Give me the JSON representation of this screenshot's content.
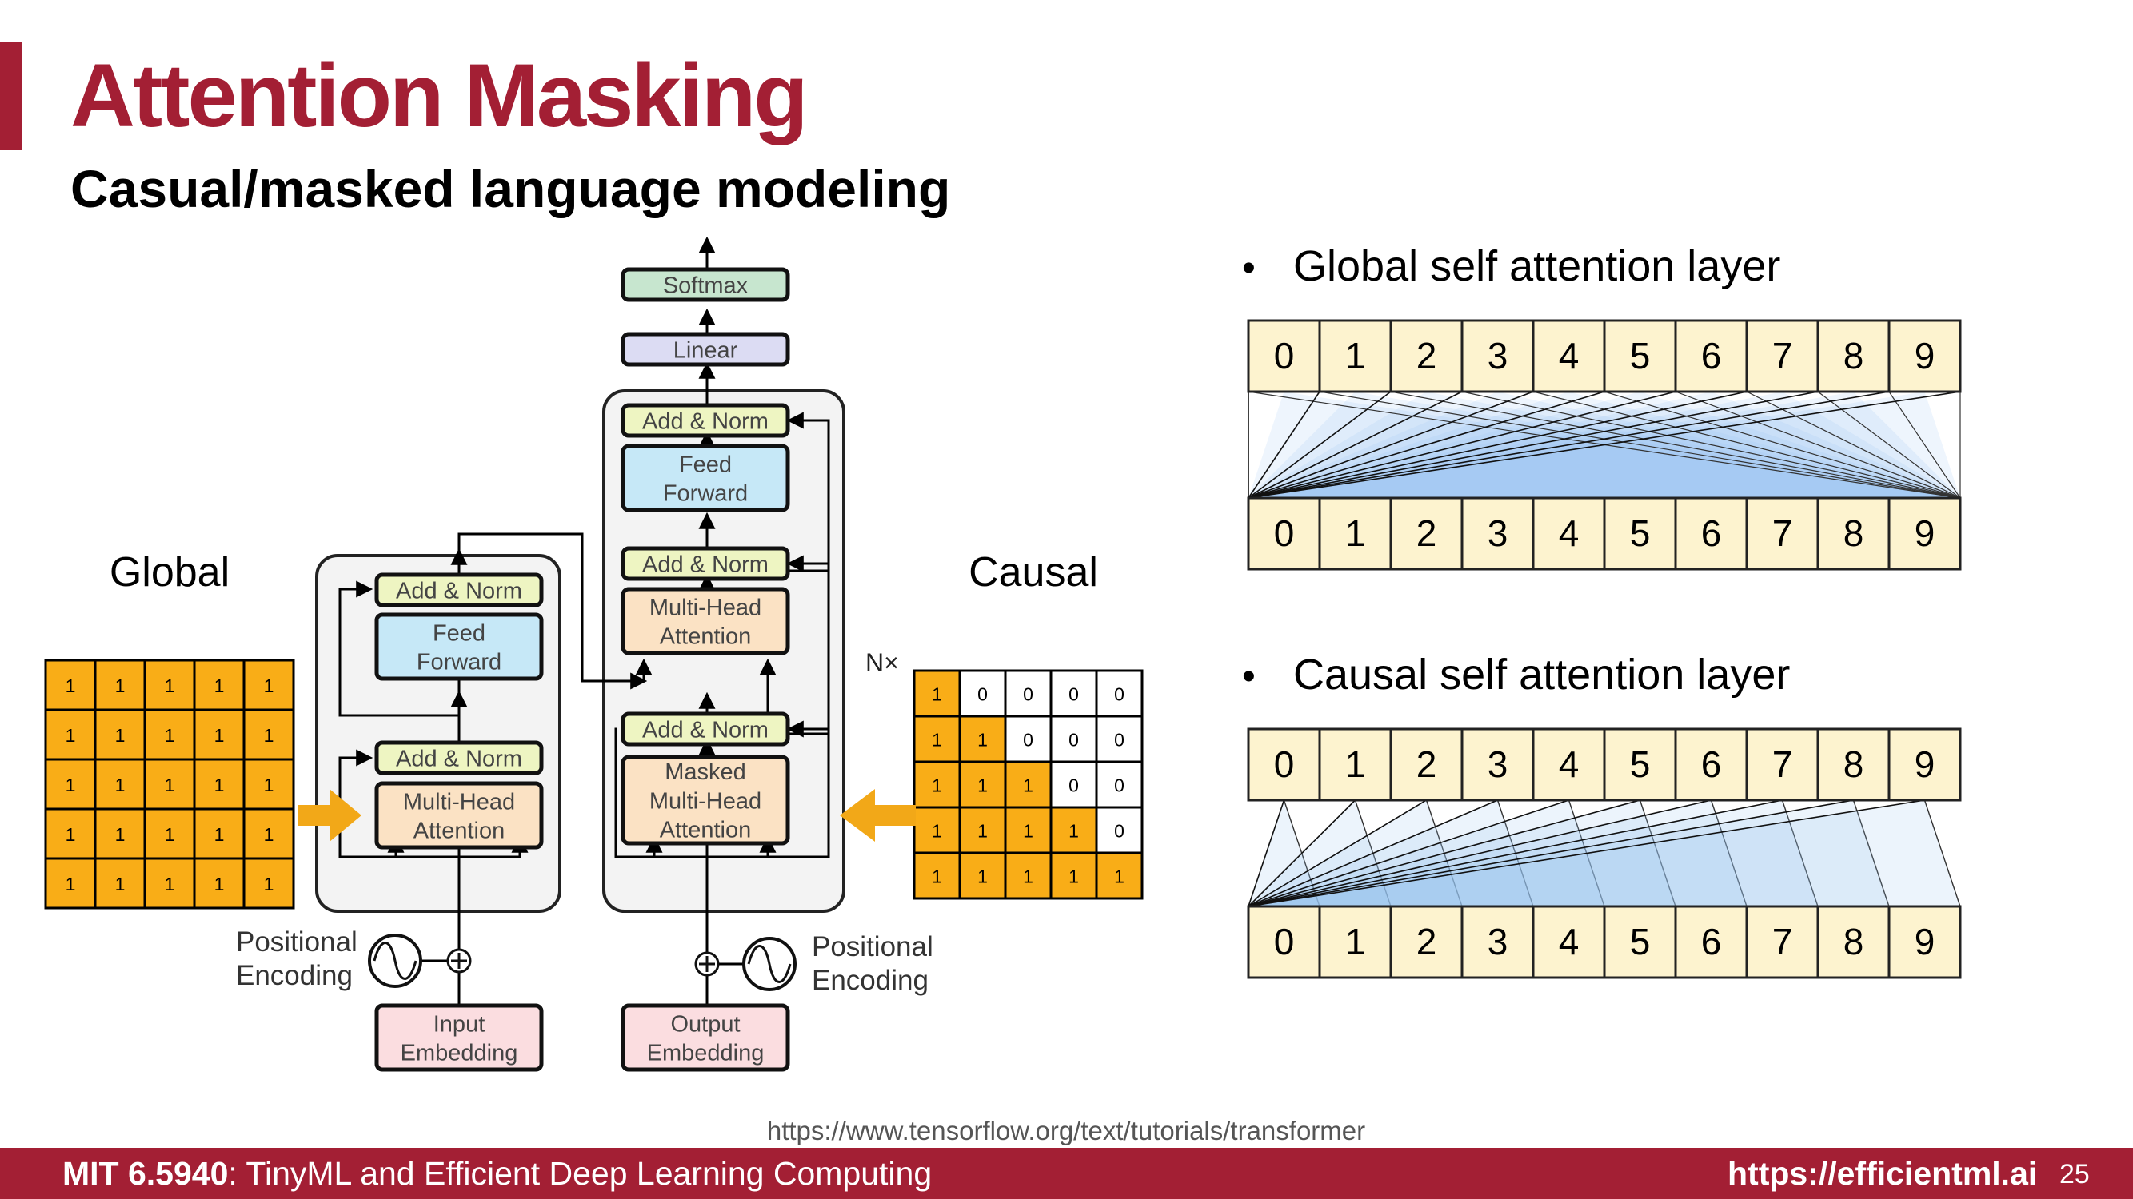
{
  "slide": {
    "title": "Attention Masking",
    "subtitle": "Casual/masked language modeling",
    "source_url": "https://www.tensorflow.org/text/tutorials/transformer"
  },
  "transformer": {
    "encoder": {
      "add_norm": "Add & Norm",
      "feed_forward": [
        "Feed",
        "Forward"
      ],
      "attention": [
        "Multi-Head",
        "Attention"
      ],
      "positional": [
        "Positional",
        "Encoding"
      ],
      "embedding": [
        "Input",
        "Embedding"
      ]
    },
    "decoder": {
      "softmax": "Softmax",
      "linear": "Linear",
      "add_norm": "Add & Norm",
      "feed_forward": [
        "Feed",
        "Forward"
      ],
      "attention": [
        "Multi-Head",
        "Attention"
      ],
      "masked_attention": [
        "Masked",
        "Multi-Head",
        "Attention"
      ],
      "positional": [
        "Positional",
        "Encoding"
      ],
      "embedding": [
        "Output",
        "Embedding"
      ],
      "repeat_label": "N×"
    }
  },
  "masks": {
    "global": {
      "label": "Global",
      "matrix": [
        [
          1,
          1,
          1,
          1,
          1
        ],
        [
          1,
          1,
          1,
          1,
          1
        ],
        [
          1,
          1,
          1,
          1,
          1
        ],
        [
          1,
          1,
          1,
          1,
          1
        ],
        [
          1,
          1,
          1,
          1,
          1
        ]
      ]
    },
    "causal": {
      "label": "Causal",
      "matrix": [
        [
          1,
          0,
          0,
          0,
          0
        ],
        [
          1,
          1,
          0,
          0,
          0
        ],
        [
          1,
          1,
          1,
          0,
          0
        ],
        [
          1,
          1,
          1,
          1,
          0
        ],
        [
          1,
          1,
          1,
          1,
          1
        ]
      ]
    }
  },
  "attention_layers": [
    {
      "bullet": "•",
      "title": "Global self attention layer",
      "tokens": [
        "0",
        "1",
        "2",
        "3",
        "4",
        "5",
        "6",
        "7",
        "8",
        "9"
      ],
      "type": "global"
    },
    {
      "bullet": "•",
      "title": "Causal self attention layer",
      "tokens": [
        "0",
        "1",
        "2",
        "3",
        "4",
        "5",
        "6",
        "7",
        "8",
        "9"
      ],
      "type": "causal"
    }
  ],
  "footer": {
    "course_code": "MIT 6.5940",
    "course_name": ": TinyML and Efficient Deep Learning Computing",
    "url": "https://efficientml.ai",
    "page": "25"
  },
  "colors": {
    "brand": "#a31f34",
    "mask_on": "#f9ad17",
    "token_fill": "#fdf3cf",
    "add_norm": "#eef5c2",
    "feed_forward": "#c6e8f7",
    "attention": "#fbe2c4",
    "embedding": "#fbdde0",
    "softmax": "#c7e6cf",
    "linear": "#dcdcf3",
    "arrow": "#f2a818"
  }
}
